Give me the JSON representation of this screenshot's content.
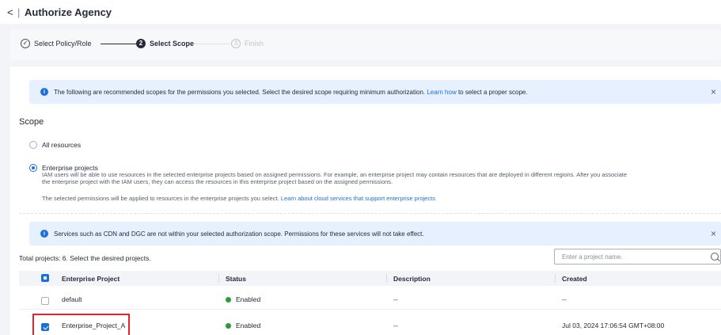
{
  "header": {
    "back_glyph": "<",
    "separator": "|",
    "title": "Authorize Agency"
  },
  "steps": [
    {
      "label": "Select Policy/Role",
      "state": "done",
      "marker": "✓"
    },
    {
      "label": "Select Scope",
      "state": "active",
      "marker": "2"
    },
    {
      "label": "Finish",
      "state": "todo",
      "marker": "3"
    }
  ],
  "alert1": {
    "text_before": "The following are recommended scopes for the permissions you selected. Select the desired scope requiring minimum authorization.",
    "link": "Learn how",
    "text_after": "to select a proper scope."
  },
  "scope": {
    "heading": "Scope",
    "options": [
      {
        "label": "All resources",
        "selected": false
      },
      {
        "label": "Enterprise projects",
        "selected": true
      }
    ],
    "desc_line1": "IAM users will be able to use resources in the selected enterprise projects based on assigned permissions. For example, an enterprise project may contain resources that are deployed in different regions. After you associate",
    "desc_line2": "the enterprise project with the IAM users, they can access the resources in this enterprise project based on the assigned permissions.",
    "note": "The selected permissions will be applied to resources in the enterprise projects you select.",
    "note_link": "Learn about cloud services that support enterprise projects"
  },
  "alert2": {
    "text": "Services such as CDN and DGC are not within your selected authorization scope. Permissions for these services will not take effect."
  },
  "table": {
    "total_text": "Total projects: 6. Select the desired projects.",
    "search_placeholder": "Enter a project name.",
    "columns": [
      "Enterprise Project",
      "Status",
      "Description",
      "Created"
    ],
    "rows": [
      {
        "project": "default",
        "status": "Enabled",
        "description": "--",
        "created": "--",
        "checked": false
      },
      {
        "project": "Enterprise_Project_A",
        "status": "Enabled",
        "description": "--",
        "created": "Jul 03, 2024 17:06:54 GMT+08:00",
        "checked": true
      }
    ]
  },
  "colors": {
    "accent": "#1e6fd9",
    "enabled": "#2a9b3a",
    "alert_bg": "#e6f0ff",
    "highlight": "#e0262d"
  },
  "icons": {
    "info": "info-icon",
    "close": "close-icon",
    "search": "search-icon",
    "check": "check-icon"
  }
}
